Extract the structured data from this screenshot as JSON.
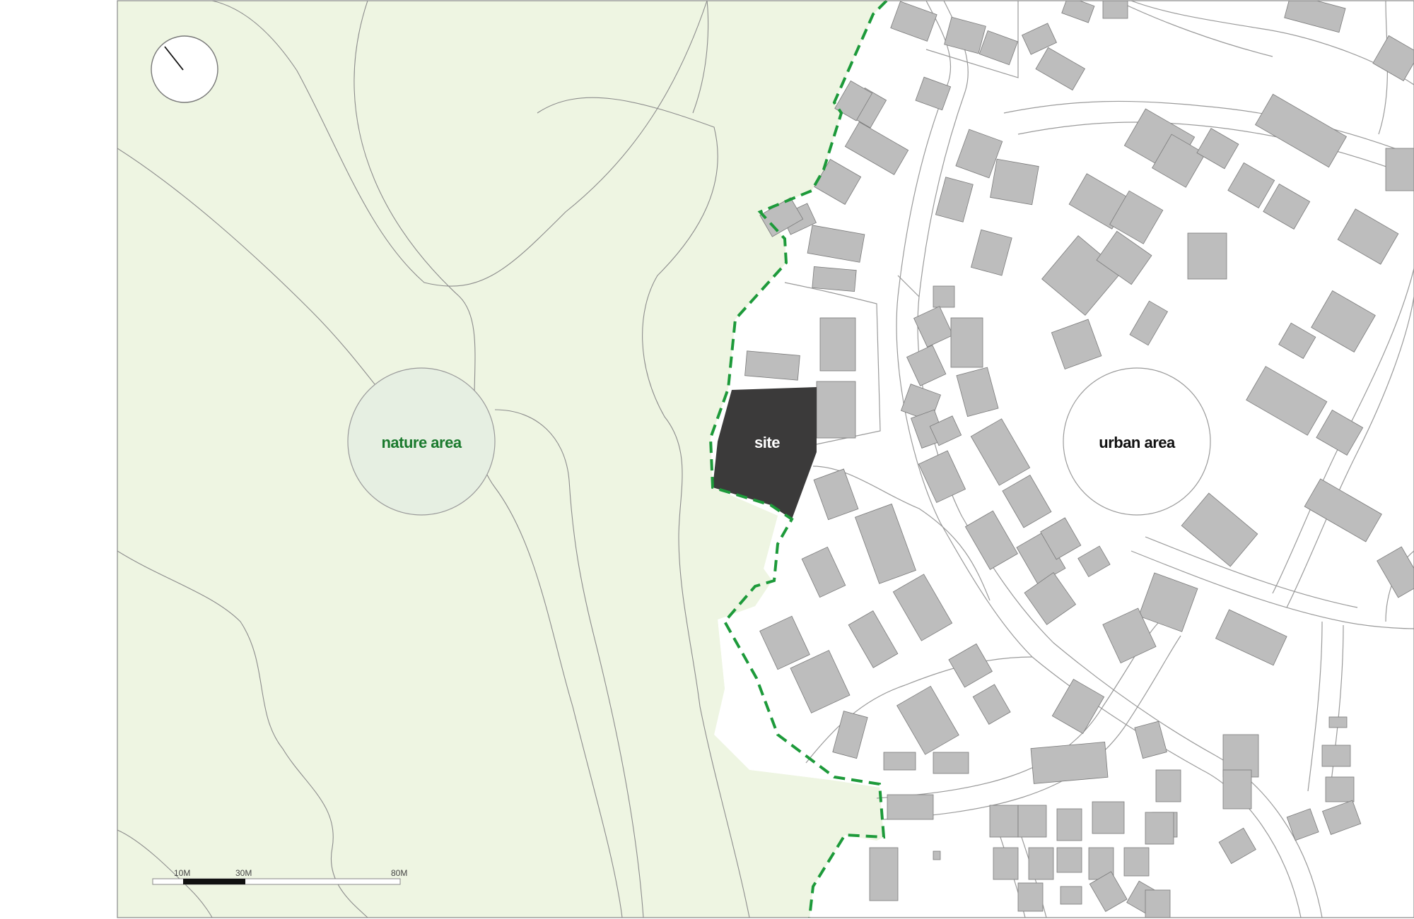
{
  "map": {
    "labels": {
      "nature": "nature area",
      "site": "site",
      "urban": "urban area"
    },
    "scale_bar": {
      "ticks": [
        "10M",
        "30M",
        "80M"
      ]
    },
    "north_arrow": {
      "icon": "north-arrow-icon"
    },
    "colors": {
      "nature_fill": "#eef5e2",
      "nature_circle": "#e6efe2",
      "nature_label": "#1b7a2e",
      "boundary": "#1d9a3a",
      "site_fill": "#3b3a3a",
      "building": "#bdbdbd",
      "road_edge": "#9a9a9a",
      "contour": "#8c8c8c",
      "urban_circle": "#ffffff",
      "urban_label": "#111111",
      "site_label": "#ffffff"
    }
  }
}
